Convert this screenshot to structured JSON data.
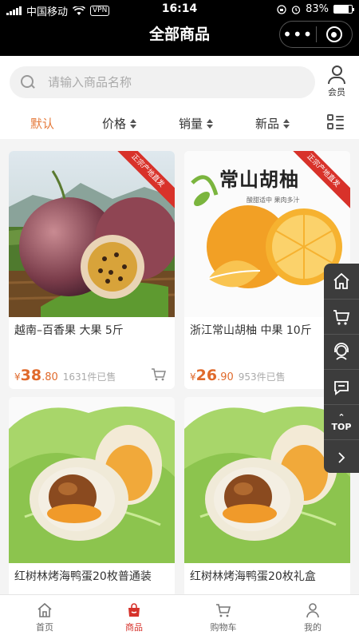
{
  "status": {
    "carrier": "中国移动",
    "vpn": "VPN",
    "time": "16:14",
    "battery": "83%",
    "battery_level": 0.83
  },
  "header": {
    "title": "全部商品"
  },
  "search": {
    "placeholder": "请输入商品名称",
    "member_label": "会员"
  },
  "sort": {
    "items": [
      {
        "label": "默认",
        "active": true
      },
      {
        "label": "价格"
      },
      {
        "label": "销量"
      },
      {
        "label": "新品"
      }
    ]
  },
  "products": [
    {
      "name": "越南–百香果 大果 5斤",
      "price_yen": "¥",
      "price_int": "38",
      "price_dec": ".80",
      "sold": "1631件已售",
      "ribbon": "正宗产地直发"
    },
    {
      "name": "浙江常山胡柚 中果 10斤",
      "price_yen": "¥",
      "price_int": "26",
      "price_dec": ".90",
      "sold": "953件已售",
      "ribbon": "正宗产地直发",
      "img_title": "常山胡柚",
      "img_sub": "酸甜适中  果肉多汁"
    },
    {
      "name": "红树林烤海鸭蛋20枚普通装"
    },
    {
      "name": "红树林烤海鸭蛋20枚礼盒"
    }
  ],
  "side": {
    "top_label": "TOP"
  },
  "tabbar": {
    "tabs": [
      {
        "label": "首页"
      },
      {
        "label": "商品",
        "active": true
      },
      {
        "label": "购物车"
      },
      {
        "label": "我的"
      }
    ]
  },
  "colors": {
    "accent": "#e57a3b",
    "price": "#e06a2c",
    "tab_active": "#d6322b"
  }
}
